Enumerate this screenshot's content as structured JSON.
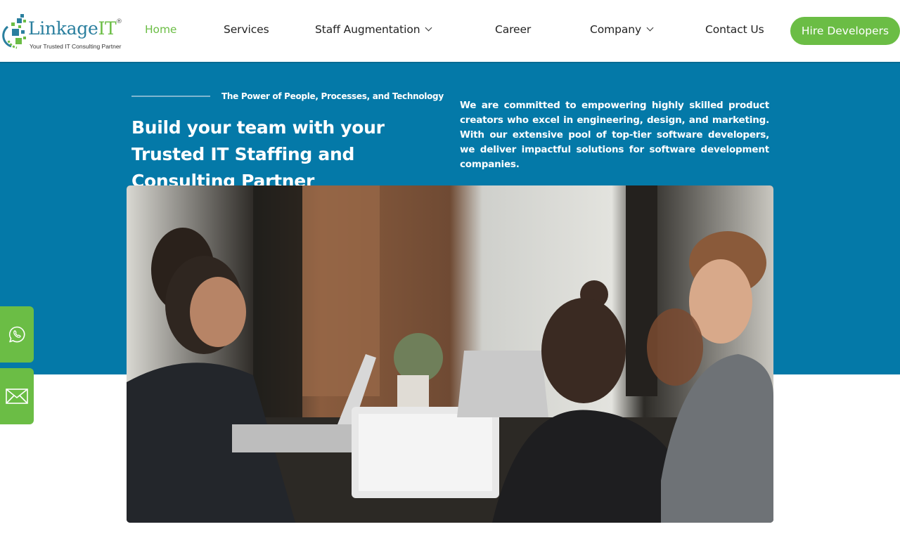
{
  "brand": {
    "name_main": "Linkage",
    "name_accent": "IT",
    "registered": "®",
    "tagline": "Your Trusted IT Consulting Partner"
  },
  "nav": {
    "items": [
      {
        "label": "Home",
        "active": true,
        "has_dropdown": false
      },
      {
        "label": "Services",
        "active": false,
        "has_dropdown": false
      },
      {
        "label": "Staff Augmentation",
        "active": false,
        "has_dropdown": true
      },
      {
        "label": "Career",
        "active": false,
        "has_dropdown": false
      },
      {
        "label": "Company",
        "active": false,
        "has_dropdown": true
      },
      {
        "label": "Contact Us",
        "active": false,
        "has_dropdown": false
      }
    ],
    "cta_label": "Hire Developers"
  },
  "hero": {
    "kicker": "The Power of People, Processes, and Technology",
    "title": "Build your team with your Trusted IT Staffing and Consulting Partner",
    "description": "We are committed to empowering highly skilled product creators who excel in engineering, design, and marketing. With our extensive pool of top-tier software developers, we deliver impactful solutions for software development companies.",
    "image_alt": "Team of developers working on laptops at a shared table"
  },
  "side_actions": [
    {
      "name": "whatsapp",
      "icon": "whatsapp-icon"
    },
    {
      "name": "email",
      "icon": "mail-icon"
    }
  ],
  "colors": {
    "brand_green": "#6bbd45",
    "hero_blue": "#0479a8",
    "logo_blue": "#2a7f9e",
    "text_dark": "#222222"
  }
}
